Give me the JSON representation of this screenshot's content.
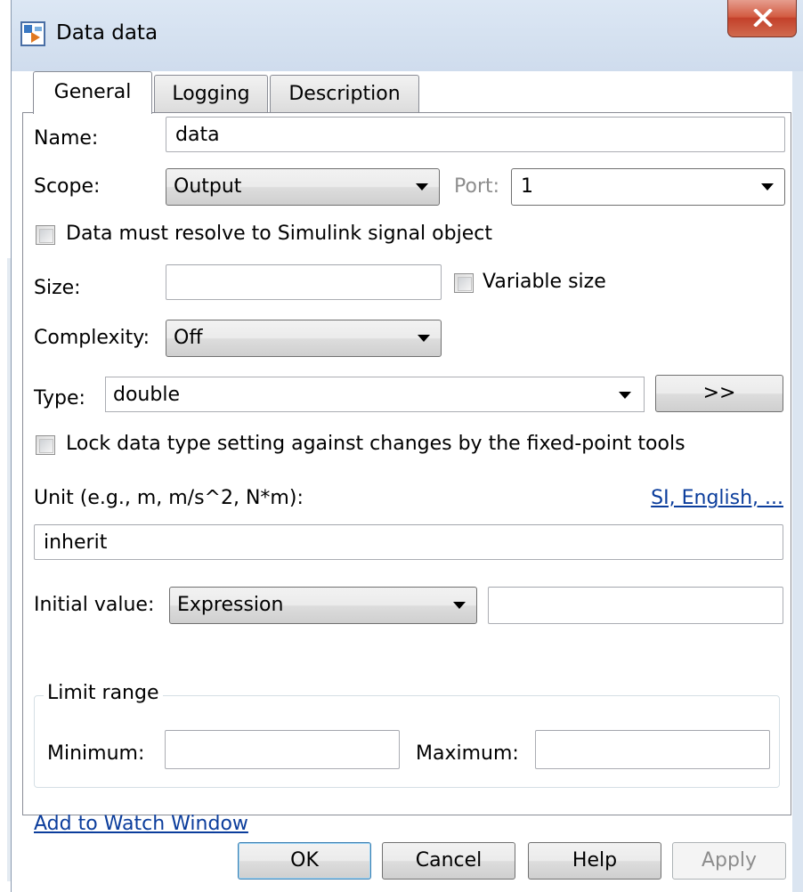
{
  "window": {
    "title": "Data data",
    "close_glyph": "X"
  },
  "tabs": [
    {
      "label": "General",
      "active": true
    },
    {
      "label": "Logging",
      "active": false
    },
    {
      "label": "Description",
      "active": false
    }
  ],
  "form": {
    "name_label": "Name:",
    "name_value": "data",
    "scope_label": "Scope:",
    "scope_value": "Output",
    "port_label": "Port:",
    "port_value": "1",
    "resolve_label": "Data must resolve to Simulink signal object",
    "resolve_checked": false,
    "size_label": "Size:",
    "size_value": "",
    "variable_size_label": "Variable size",
    "variable_size_checked": false,
    "complexity_label": "Complexity:",
    "complexity_value": "Off",
    "type_label": "Type:",
    "type_value": "double",
    "type_assistant_label": ">>",
    "lock_label": "Lock data type setting against changes by the fixed-point tools",
    "lock_checked": false,
    "unit_label": "Unit (e.g., m, m/s^2, N*m):",
    "unit_link": "SI, English, ...",
    "unit_value": "inherit",
    "initial_value_label": "Initial value:",
    "initial_value_mode": "Expression",
    "initial_value_value": "",
    "limit_range_title": "Limit range",
    "minimum_label": "Minimum:",
    "minimum_value": "",
    "maximum_label": "Maximum:",
    "maximum_value": "",
    "watch_link": "Add to Watch Window"
  },
  "buttons": {
    "ok": "OK",
    "cancel": "Cancel",
    "help": "Help",
    "apply": "Apply"
  },
  "colors": {
    "link": "#0b3d9c",
    "frame": "#dbe5f1",
    "close": "#c3402a"
  }
}
